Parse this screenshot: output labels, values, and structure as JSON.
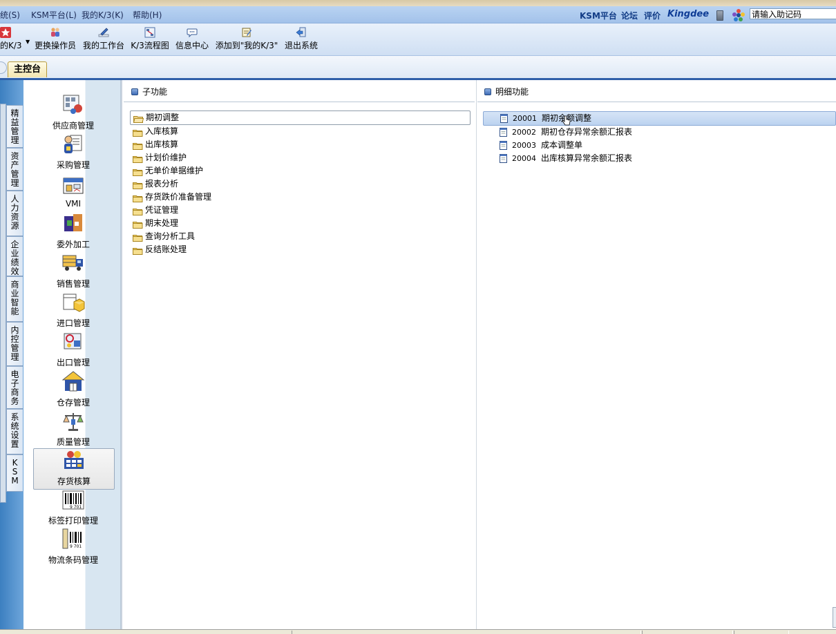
{
  "menubar": {
    "items": [
      "统(S)",
      "KSM平台(L)",
      "我的K/3(K)",
      "帮助(H)"
    ],
    "links": [
      "KSM平台",
      "论坛",
      "评价"
    ],
    "brand": "Kingdee",
    "helper_placeholder": "请输入助记码"
  },
  "toolbar": {
    "items": [
      {
        "label": "的K/3",
        "icon": "star-icon"
      },
      {
        "label": "更换操作员",
        "icon": "users-icon"
      },
      {
        "label": "我的工作台",
        "icon": "pen-icon"
      },
      {
        "label": "K/3流程图",
        "icon": "flowchart-icon"
      },
      {
        "label": "信息中心",
        "icon": "message-icon"
      },
      {
        "label": "添加到\"我的K/3\"",
        "icon": "add-note-icon"
      },
      {
        "label": "退出系统",
        "icon": "exit-icon"
      }
    ]
  },
  "tabs": {
    "main": "主控台"
  },
  "side_tabs": [
    {
      "label": "精益管理",
      "active": false
    },
    {
      "label": "资产管理",
      "active": false
    },
    {
      "label": "人力资源",
      "active": false
    },
    {
      "label": "企业绩效",
      "active": false
    },
    {
      "label": "商业智能",
      "active": false
    },
    {
      "label": "内控管理",
      "active": false
    },
    {
      "label": "电子商务",
      "active": false
    },
    {
      "label": "系统设置",
      "active": false
    },
    {
      "label": "KSM",
      "active": false
    }
  ],
  "nav": {
    "items": [
      {
        "label": "供应商管理",
        "icon": "supplier-icon"
      },
      {
        "label": "采购管理",
        "icon": "purchase-icon"
      },
      {
        "label": "VMI",
        "icon": "vmi-icon"
      },
      {
        "label": "委外加工",
        "icon": "outsourcing-icon"
      },
      {
        "label": "销售管理",
        "icon": "sales-truck-icon"
      },
      {
        "label": "进口管理",
        "icon": "import-icon"
      },
      {
        "label": "出口管理",
        "icon": "export-icon"
      },
      {
        "label": "仓存管理",
        "icon": "warehouse-icon"
      },
      {
        "label": "质量管理",
        "icon": "quality-scale-icon"
      },
      {
        "label": "存货核算",
        "icon": "inventory-accounting-icon"
      },
      {
        "label": "标签打印管理",
        "icon": "barcode-label-icon"
      },
      {
        "label": "物流条码管理",
        "icon": "logistics-barcode-icon"
      }
    ],
    "selected": "存货核算"
  },
  "subfunctions": {
    "title": "子功能",
    "items": [
      "期初调整",
      "入库核算",
      "出库核算",
      "计划价维护",
      "无单价单据维护",
      "报表分析",
      "存货跌价准备管理",
      "凭证管理",
      "期末处理",
      "查询分析工具",
      "反结账处理"
    ],
    "selected": "期初调整"
  },
  "details": {
    "title": "明细功能",
    "items": [
      {
        "code": "20001",
        "name": "期初余额调整"
      },
      {
        "code": "20002",
        "name": "期初仓存异常余额汇报表"
      },
      {
        "code": "20003",
        "name": "成本调整单"
      },
      {
        "code": "20004",
        "name": "出库核算异常余额汇报表"
      }
    ],
    "selected": "20001"
  },
  "colors": {
    "menubar": "#a3c2ea",
    "tab_underline": "#2f5fa9",
    "selected_row": "#bcd3f0",
    "nav_strip": "#d8e6f1"
  }
}
